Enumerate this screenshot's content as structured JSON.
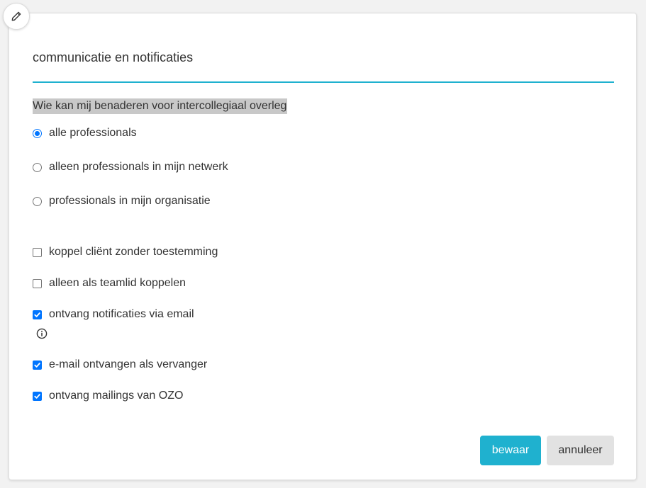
{
  "section": {
    "title": "communicatie en notificaties"
  },
  "contact": {
    "question": "Wie kan mij benaderen voor intercollegiaal overleg",
    "options": [
      {
        "label": "alle professionals",
        "checked": true
      },
      {
        "label": "alleen professionals in mijn netwerk",
        "checked": false
      },
      {
        "label": "professionals in mijn organisatie",
        "checked": false
      }
    ]
  },
  "settings": [
    {
      "label": "koppel cliënt zonder toestemming",
      "checked": false
    },
    {
      "label": "alleen als teamlid koppelen",
      "checked": false
    },
    {
      "label": "ontvang notificaties via email",
      "checked": true
    },
    {
      "label": "e-mail ontvangen als vervanger",
      "checked": true
    },
    {
      "label": "ontvang mailings van OZO",
      "checked": true
    }
  ],
  "actions": {
    "save_label": "bewaar",
    "cancel_label": "annuleer"
  },
  "colors": {
    "accent": "#1fb1cf",
    "control_checked": "#0075ff"
  },
  "icons": {
    "edit": "pencil-icon",
    "info": "info-icon"
  }
}
